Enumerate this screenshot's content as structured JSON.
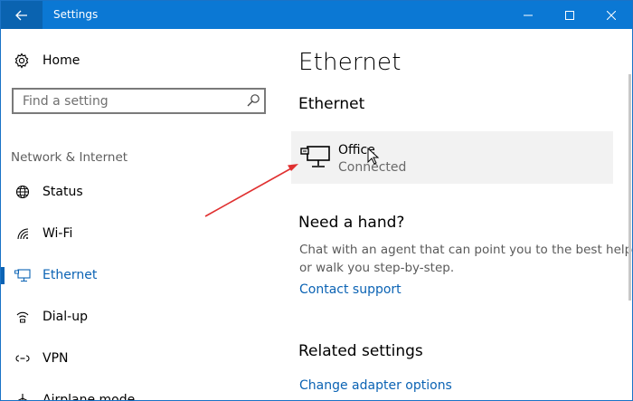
{
  "window": {
    "title": "Settings"
  },
  "sidebar": {
    "home_label": "Home",
    "search_placeholder": "Find a setting",
    "section_label": "Network & Internet",
    "items": [
      {
        "label": "Status",
        "icon": "globe-icon",
        "active": false
      },
      {
        "label": "Wi-Fi",
        "icon": "wifi-icon",
        "active": false
      },
      {
        "label": "Ethernet",
        "icon": "ethernet-icon",
        "active": true
      },
      {
        "label": "Dial-up",
        "icon": "dialup-icon",
        "active": false
      },
      {
        "label": "VPN",
        "icon": "vpn-icon",
        "active": false
      },
      {
        "label": "Airplane mode",
        "icon": "airplane-icon",
        "active": false
      }
    ]
  },
  "main": {
    "page_title": "Ethernet",
    "section_title": "Ethernet",
    "network": {
      "name": "Office",
      "status": "Connected"
    },
    "help": {
      "title": "Need a hand?",
      "text": "Chat with an agent that can point you to the best help or walk you step-by-step.",
      "link": "Contact support"
    },
    "related": {
      "title": "Related settings",
      "link": "Change adapter options"
    }
  },
  "colors": {
    "titlebar": "#0b78d4",
    "accent": "#0b63b4",
    "annotation_arrow": "#e03030"
  }
}
